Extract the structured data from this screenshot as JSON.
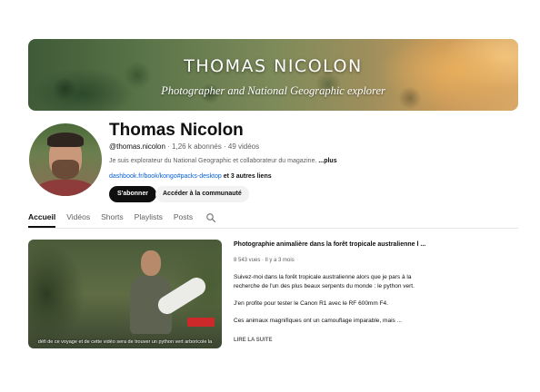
{
  "banner": {
    "title": "THOMAS NICOLON",
    "subtitle": "Photographer and National Geographic explorer"
  },
  "channel": {
    "name": "Thomas Nicolon",
    "handle": "@thomas.nicolon",
    "stats": " · 1,26 k abonnés · 49 vidéos",
    "description": "Je suis explorateur du National Geographic et collaborateur du magazine. ",
    "more_label": "...plus",
    "link_text": "dashbook.fr/book/kongo#packs-desktop",
    "extra_links": " et 3 autres liens"
  },
  "buttons": {
    "subscribe": "S'abonner",
    "community": "Accéder à la communauté"
  },
  "tabs": [
    {
      "label": "Accueil",
      "active": true
    },
    {
      "label": "Vidéos",
      "active": false
    },
    {
      "label": "Shorts",
      "active": false
    },
    {
      "label": "Playlists",
      "active": false
    },
    {
      "label": "Posts",
      "active": false
    }
  ],
  "icons": {
    "search": "search-icon"
  },
  "featured_video": {
    "title": "Photographie animalière dans la forêt tropicale australienne l ...",
    "meta": "8 543 vues · Il y a 3 mois",
    "description": [
      "Suivez-moi dans la forêt tropicale australienne alors que je pars à la recherche de l'un des plus beaux serpents du monde : le python vert.",
      "J'en profite pour tester le Canon R1 avec le RF 600mm F4.",
      "Ces animaux magnifiques ont un camouflage imparable, mais ..."
    ],
    "read_more": "LIRE LA SUITE",
    "thumbnail_caption": "défi de ce voyage et de cette vidéo sera de trouver un python vert arboricole la"
  },
  "colors": {
    "subscribe_bg": "#0f0f0f",
    "link": "#065fd4",
    "muted": "#606060"
  }
}
